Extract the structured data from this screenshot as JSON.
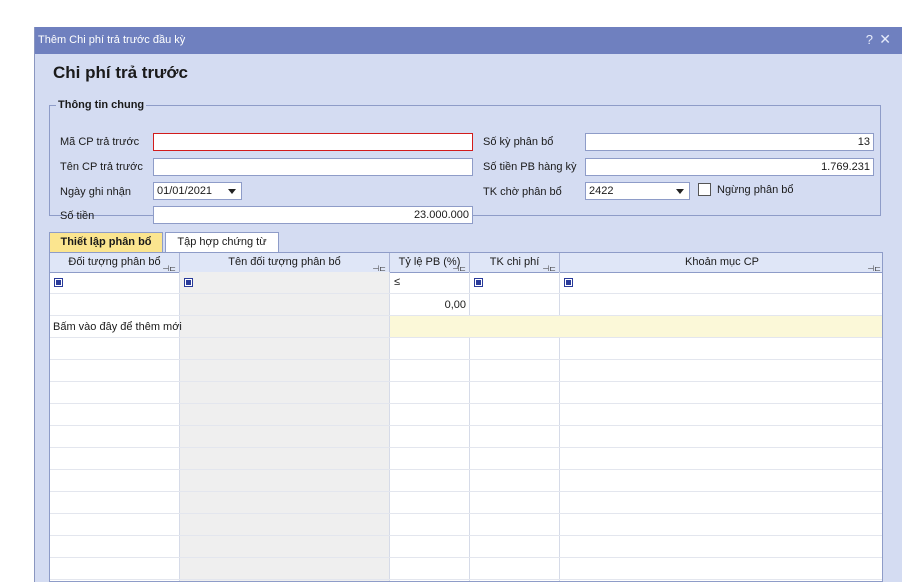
{
  "window": {
    "title": "Thêm Chi phí trả trước đầu kỳ",
    "help_glyph": "?",
    "close_glyph": "✕"
  },
  "heading": "Chi phí trả trước",
  "general": {
    "legend": "Thông tin chung",
    "code_label": "Mã CP trả trước",
    "code_value": "",
    "name_label": "Tên CP trả trước",
    "name_value": "",
    "date_label": "Ngày ghi nhận",
    "date_value": "01/01/2021",
    "amount_label": "Số tiền",
    "amount_value": "23.000.000",
    "periods_label": "Số kỳ phân bổ",
    "periods_value": "13",
    "per_period_label": "Số tiền PB hàng kỳ",
    "per_period_value": "1.769.231",
    "pending_account_label": "TK chờ phân bổ",
    "pending_account_value": "2422",
    "stop_label": "Ngừng phân bổ"
  },
  "tabs": [
    {
      "label": "Thiết lập phân bổ",
      "active": true
    },
    {
      "label": "Tập hợp chứng từ",
      "active": false
    }
  ],
  "grid": {
    "columns": [
      "Đối tượng phân bổ",
      "Tên đối tượng phân bổ",
      "Tỷ lệ PB (%)",
      "TK chi phí",
      "Khoản mục CP"
    ],
    "filter_operator": "≤",
    "total_rate": "0,00",
    "add_new_hint": "Bấm vào đây để thêm mới"
  },
  "colors": {
    "titlebar": "#6f80bf",
    "active_tab": "#fbe58f",
    "error_border": "#d21c1c",
    "new_row": "#fbf8d8",
    "readonly_column": "#efefef"
  }
}
